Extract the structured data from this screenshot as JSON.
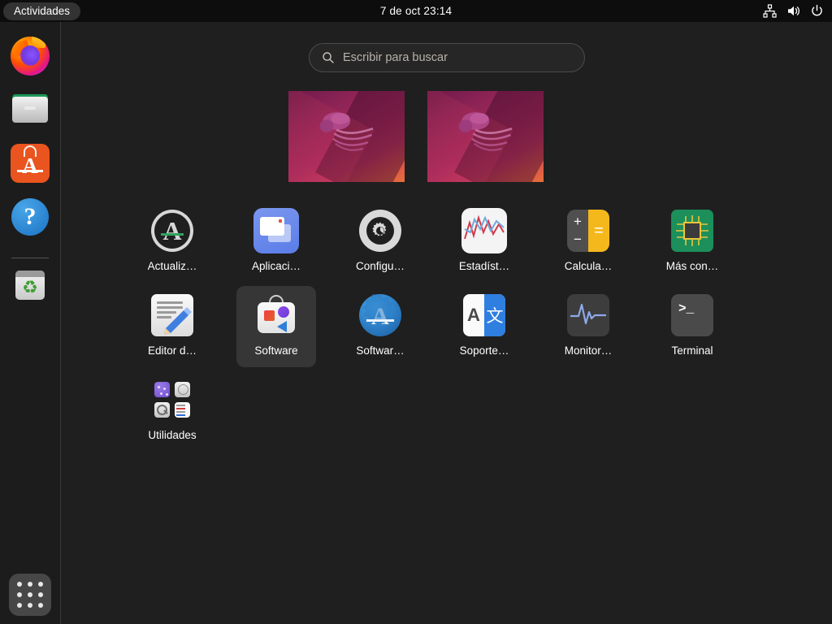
{
  "topbar": {
    "activities_label": "Actividades",
    "clock": "7 de oct  23:14",
    "tray": [
      {
        "name": "network-icon",
        "label": "Red"
      },
      {
        "name": "volume-icon",
        "label": "Volumen"
      },
      {
        "name": "power-icon",
        "label": "Apagar"
      }
    ]
  },
  "dock": {
    "items": [
      {
        "name": "firefox",
        "label": "Firefox"
      },
      {
        "name": "files",
        "label": "Archivos"
      },
      {
        "name": "ubuntu-software",
        "label": "Software de Ubuntu"
      },
      {
        "name": "help",
        "label": "Ayuda"
      },
      {
        "name": "trash",
        "label": "Papelera"
      }
    ],
    "show_apps_label": "Mostrar aplicaciones"
  },
  "search": {
    "placeholder": "Escribir para buscar",
    "value": ""
  },
  "workspaces": [
    {
      "name": "workspace-1",
      "label": "Área de trabajo 1",
      "selected": true
    },
    {
      "name": "workspace-2",
      "label": "Área de trabajo 2",
      "selected": false
    }
  ],
  "apps": [
    {
      "id": "updater",
      "label": "Actualiz…",
      "icon": "software-updater-icon",
      "selected": false
    },
    {
      "id": "startup",
      "label": "Aplicaci…",
      "icon": "startup-applications-icon",
      "selected": false
    },
    {
      "id": "settings",
      "label": "Configu…",
      "icon": "settings-gear-icon",
      "selected": false
    },
    {
      "id": "stats",
      "label": "Estadíst…",
      "icon": "statistics-chart-icon",
      "selected": false
    },
    {
      "id": "calc",
      "label": "Calcula…",
      "icon": "calculator-icon",
      "selected": false
    },
    {
      "id": "moreconf",
      "label": "Más con…",
      "icon": "circuit-chip-icon",
      "selected": false
    },
    {
      "id": "editor",
      "label": "Editor d…",
      "icon": "text-editor-icon",
      "selected": false
    },
    {
      "id": "software",
      "label": "Software",
      "icon": "gnome-software-bag-icon",
      "selected": true
    },
    {
      "id": "swcenter",
      "label": "Softwar…",
      "icon": "software-center-icon",
      "selected": false
    },
    {
      "id": "support",
      "label": "Soporte…",
      "icon": "language-support-icon",
      "selected": false
    },
    {
      "id": "monitor",
      "label": "Monitor…",
      "icon": "system-monitor-icon",
      "selected": false
    },
    {
      "id": "terminal",
      "label": "Terminal",
      "icon": "terminal-icon",
      "selected": false
    },
    {
      "id": "utilities",
      "label": "Utilidades",
      "icon": "folder-utilities-icon",
      "selected": false
    }
  ],
  "calculator": {
    "plus": "+",
    "minus": "−",
    "equals": "="
  },
  "language_icon": {
    "latin": "A",
    "cjk": "文"
  },
  "terminal_icon": {
    "prompt": ">_"
  },
  "trash_icon": {
    "glyph": "♻"
  },
  "help_icon": {
    "glyph": "?"
  },
  "software_icon": {
    "glyph": "A"
  },
  "colors": {
    "desktop_bg": "#1f1f1f",
    "topbar_bg": "#0d0d0d",
    "dock_bg": "#1c1c1c",
    "selection_bg": "#363636",
    "accent_orange": "#e9541f",
    "accent_yellow": "#f5b81c",
    "accent_green": "#2fa45f",
    "text": "#ffffff",
    "placeholder_text": "#b9b2ab"
  }
}
